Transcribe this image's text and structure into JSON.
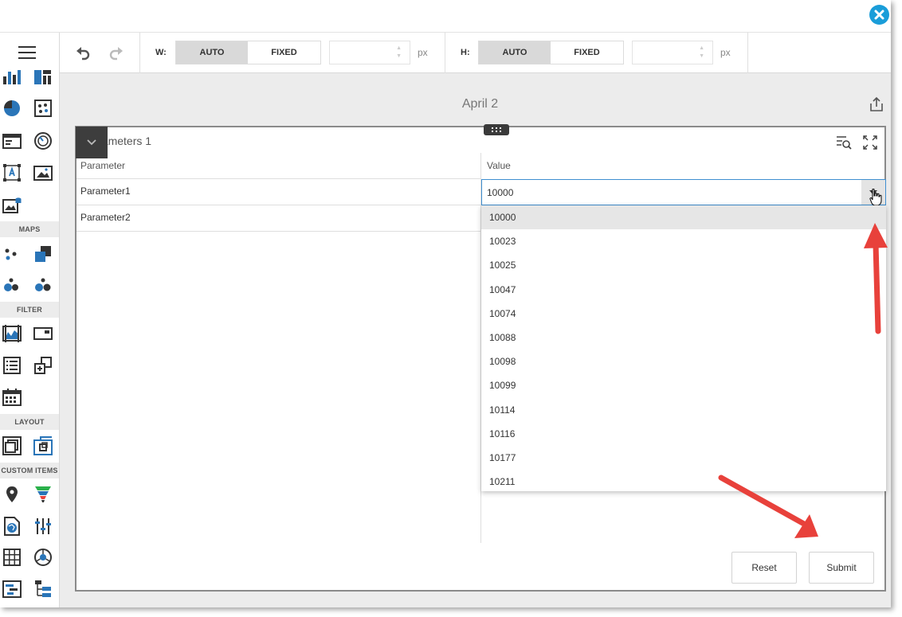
{
  "toolbar": {
    "width_label": "W:",
    "height_label": "H:",
    "auto_label": "AUTO",
    "fixed_label": "FIXED",
    "unit": "px",
    "width_value": "",
    "height_value": ""
  },
  "sidebar": {
    "sections": [
      "MAPS",
      "FILTER",
      "LAYOUT",
      "CUSTOM ITEMS"
    ]
  },
  "dashboard": {
    "title": "April 2"
  },
  "item": {
    "caption": "Parameters 1",
    "columns": [
      "Parameter",
      "Value"
    ],
    "rows": [
      {
        "name": "Parameter1",
        "value": "10000"
      },
      {
        "name": "Parameter2",
        "value": ""
      }
    ],
    "dropdown_options": [
      "10000",
      "10023",
      "10025",
      "10047",
      "10074",
      "10088",
      "10098",
      "10099",
      "10114",
      "10116",
      "10177",
      "10211"
    ],
    "selected_option": "10000",
    "reset_label": "Reset",
    "submit_label": "Submit"
  },
  "colors": {
    "accent": "#1a9dd9",
    "annotation_arrow": "#e8413b",
    "icon_blue": "#2a75b8",
    "focus_border": "#3f8fd0"
  },
  "icons": [
    "close-icon",
    "hamburger-icon",
    "undo-icon",
    "redo-icon",
    "export-icon",
    "drag-handle-icon",
    "chevron-down-icon",
    "filter-search-icon",
    "maximize-icon",
    "dropdown-caret-icon",
    "pointer-cursor-icon"
  ]
}
